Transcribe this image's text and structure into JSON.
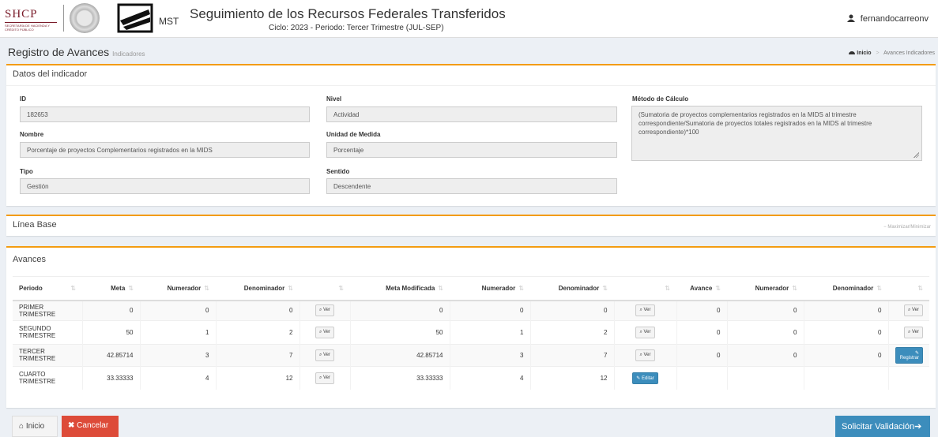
{
  "header": {
    "shcp_logo": "SHCP",
    "shcp_subtitle": "SECRETARÍA DE HACIENDA Y CRÉDITO PÚBLICO",
    "mst_label": "MST",
    "title": "Seguimiento de los Recursos Federales Transferidos",
    "subtitle": "Ciclo: 2023 - Periodo: Tercer Trimestre (JUL-SEP)",
    "user": "fernandocarreonv"
  },
  "page": {
    "title": "Registro de Avances",
    "title_small": "Indicadores",
    "breadcrumb_home": "Inicio",
    "breadcrumb_sep": ">",
    "breadcrumb_current": "Avances Indicadores"
  },
  "indicator": {
    "box_title": "Datos del indicador",
    "id_label": "ID",
    "id_value": "182653",
    "nombre_label": "Nombre",
    "nombre_value": "Porcentaje de proyectos Complementarios registrados en la MIDS",
    "tipo_label": "Tipo",
    "tipo_value": "Gestión",
    "nivel_label": "Nivel",
    "nivel_value": "Actividad",
    "unidad_label": "Unidad de Medida",
    "unidad_value": "Porcentaje",
    "sentido_label": "Sentido",
    "sentido_value": "Descendente",
    "metodo_label": "Método de Cálculo",
    "metodo_value": "(Sumatoria de proyectos complementarios  registrados en la MIDS al trimestre correspondiente/Sumatoria de proyectos totales registrados en la MIDS al trimestre correspondiente)*100"
  },
  "linea_base": {
    "title": "Línea Base",
    "toggle": "Maximizar/Minimizar"
  },
  "avances": {
    "title": "Avances",
    "columns": [
      "Periodo",
      "Meta",
      "Numerador",
      "Denominador",
      "",
      "Meta Modificada",
      "Numerador",
      "Denominador",
      "",
      "Avance",
      "Numerador",
      "Denominador",
      ""
    ],
    "rows": [
      {
        "periodo": "PRIMER TRIMESTRE",
        "meta": "0",
        "num1": "0",
        "den1": "0",
        "b1": "Ver",
        "metamod": "0",
        "num2": "0",
        "den2": "0",
        "b2": "Ver",
        "avance": "0",
        "num3": "0",
        "den3": "0",
        "b3": "Ver"
      },
      {
        "periodo": "SEGUNDO TRIMESTRE",
        "meta": "50",
        "num1": "1",
        "den1": "2",
        "b1": "Ver",
        "metamod": "50",
        "num2": "1",
        "den2": "2",
        "b2": "Ver",
        "avance": "0",
        "num3": "0",
        "den3": "0",
        "b3": "Ver"
      },
      {
        "periodo": "TERCER TRIMESTRE",
        "meta": "42.85714",
        "num1": "3",
        "den1": "7",
        "b1": "Ver",
        "metamod": "42.85714",
        "num2": "3",
        "den2": "7",
        "b2": "Ver",
        "avance": "0",
        "num3": "0",
        "den3": "0",
        "b3": "Registrar"
      },
      {
        "periodo": "CUARTO TRIMESTRE",
        "meta": "33.33333",
        "num1": "4",
        "den1": "12",
        "b1": "Ver",
        "metamod": "33.33333",
        "num2": "4",
        "den2": "12",
        "b2": "Editar",
        "avance": "",
        "num3": "",
        "den3": "",
        "b3": ""
      }
    ]
  },
  "footer": {
    "inicio": "Inicio",
    "cancelar": "Cancelar",
    "solicitar": "Solicitar Validación"
  }
}
